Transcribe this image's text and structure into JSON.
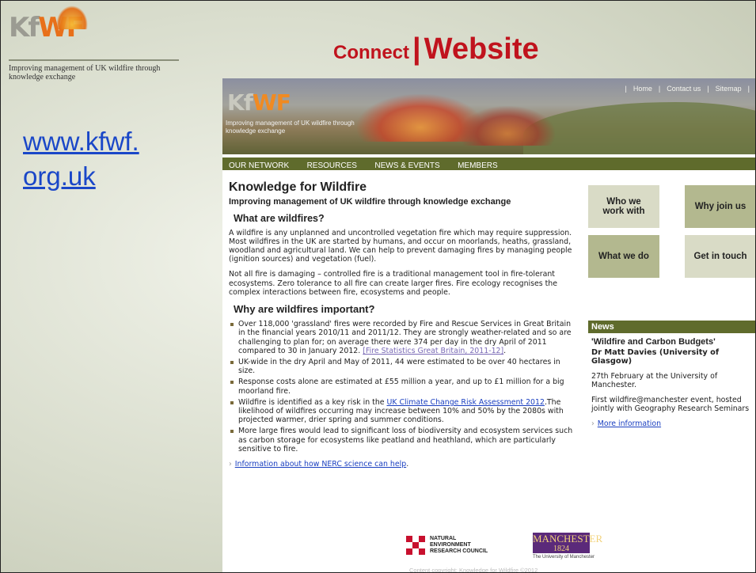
{
  "logo": {
    "mark_left": "Kf",
    "mark_right": "WF",
    "tagline": "Improving management of UK wildfire through knowledge exchange"
  },
  "slide_title": {
    "part1": "Connect",
    "separator": "|",
    "part2": "Website"
  },
  "url_text": "www.kfwf.\norg.uk",
  "website": {
    "logo_left": "Kf",
    "logo_right": "WF",
    "banner_tagline": "Improving management of UK wildfire through knowledge exchange",
    "top_nav": [
      "Home",
      "Contact us",
      "Sitemap"
    ],
    "nav": [
      "OUR NETWORK",
      "RESOURCES",
      "NEWS & EVENTS",
      "MEMBERS"
    ],
    "heading": "Knowledge for Wildfire",
    "subheading": "Improving management of UK wildfire through knowledge exchange",
    "what_title": "What are wildfires?",
    "para1": "A wildfire is any unplanned and uncontrolled vegetation fire which may require suppression. Most wildfires in the UK are started by humans, and occur on moorlands, heaths, grassland, woodland and agricultural land. We can help to prevent damaging fires by managing people (ignition sources) and vegetation (fuel).",
    "para2": "Not all fire is damaging – controlled fire is a traditional management tool in fire-tolerant ecosystems.  Zero tolerance to all fire can create larger fires.  Fire ecology recognises the complex interactions between fire, ecosystems and people.",
    "why_title": "Why are wildfires important?",
    "bullets": {
      "b1": "Over 118,000 'grassland' fires were recorded by Fire and Rescue Services in Great Britain in the financial years 2010/11 and 2011/12.  They are strongly weather-related and so are challenging to plan for; on average there were 374 per day in the dry April of 2011 compared to 30 in January 2012. ",
      "b1_link": "[Fire Statistics Great Britain, 2011-12]",
      "b1_end": ".",
      "b2": "UK-wide in the dry April and May of 2011, 44 were estimated to be over 40 hectares in size.",
      "b3": "Response costs alone are estimated at £55 million a year, and up to £1 million for a big moorland fire.",
      "b4_pre": "Wildfire is identified as a key risk in the ",
      "b4_link": "UK Climate Change Risk Assessment 2012",
      "b4_post": ".The likelihood of wildfires occurring may increase between 10% and 50% by the 2080s with projected warmer, drier spring and summer conditions.",
      "b5": "More large fires would lead to significant loss of biodiversity and ecosystem services such as carbon storage for ecosystems like peatland and heathland, which are particularly sensitive to fire."
    },
    "more_link": "Information about how NERC science can help",
    "more_link_end": ".",
    "tiles": {
      "who": "Who we\nwork with",
      "why": "Why join us",
      "what": "What we do",
      "touch": "Get in touch"
    },
    "news": {
      "header": "News",
      "title": "'Wildfire and Carbon Budgets'",
      "author": "Dr Matt Davies (University of Glasgow)",
      "date": "27th February at the University of Manchester.",
      "desc": "First wildfire@manchester event, hosted jointly with Geography Research Seminars",
      "link": "More information"
    },
    "nerc_text": "NATURAL\nENVIRONMENT\nRESEARCH COUNCIL",
    "manchester_top": "MANCHESTER",
    "manchester_year": "1824",
    "manchester_sub": "The University of Manchester",
    "copyright": "Content copyright: Knowledge for Wildfire ©2012"
  },
  "colors": {
    "title_red": "#c0131d",
    "link_blue": "#1a47c8",
    "nav_green": "#5f6b2c",
    "tile_light": "#d9dbc6",
    "tile_dark": "#b3b88f"
  }
}
